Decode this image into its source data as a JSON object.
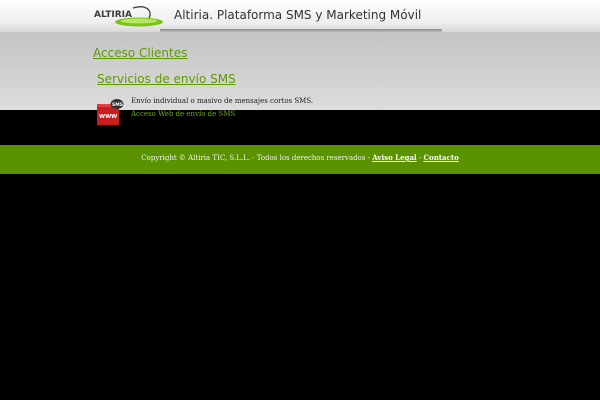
{
  "header": {
    "logo_text": "ALTIRIA",
    "title": "Altiria. Plataforma SMS y Marketing Móvil"
  },
  "content": {
    "clients_link": "Acceso Clientes",
    "services_link": "Servicios de envío SMS",
    "service": {
      "icon_badge": "SMS",
      "icon_label": "WWW",
      "description": "Envío individual o masivo de mensajes cortos SMS.",
      "link": "Acceso Web de envío de SMS"
    }
  },
  "footer": {
    "copyright": "Copyright © Altiria TIC, S.L.L. - Todos los derechos reservados - ",
    "legal_link": "Aviso Legal",
    "separator": " - ",
    "contact_link": "Contacto"
  },
  "colors": {
    "accent_green": "#5d9a00",
    "footer_green": "#5a9200",
    "background": "#000000",
    "content_grey": "#d0d0d0"
  }
}
